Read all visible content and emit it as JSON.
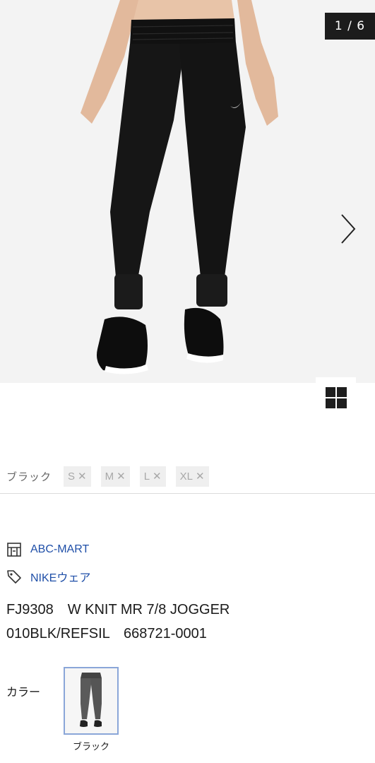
{
  "gallery": {
    "counter": "1 / 6",
    "image_alt": "product-photo-pants"
  },
  "sizes": {
    "color": "ブラック",
    "chips": [
      {
        "label": "S",
        "available": false
      },
      {
        "label": "M",
        "available": false
      },
      {
        "label": "L",
        "available": false
      },
      {
        "label": "XL",
        "available": false
      }
    ],
    "unavailable_mark": "✕"
  },
  "store": {
    "shop_name": "ABC-MART",
    "category": "NIKEウェア"
  },
  "product": {
    "line1": "FJ9308　W KNIT MR 7/8 JOGGER",
    "line2": "010BLK/REFSIL　668721-0001"
  },
  "color_select": {
    "label": "カラー",
    "swatch_name": "ブラック"
  },
  "colors": {
    "accent_link": "#1f4fa8",
    "swatch_border": "#8aa6d8"
  }
}
